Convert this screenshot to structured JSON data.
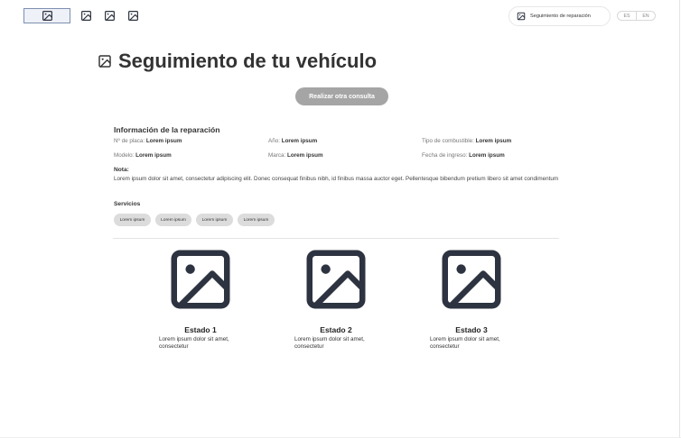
{
  "header": {
    "icons": [
      "image-icon",
      "image-icon",
      "image-icon",
      "image-icon"
    ],
    "tracking_label": "Seguimiento de reparación",
    "lang": {
      "es": "ES",
      "en": "EN"
    }
  },
  "page": {
    "title": "Seguimiento de tu vehículo",
    "consult_button": "Realizar otra consulta"
  },
  "info": {
    "heading": "Información de la reparación",
    "fields": {
      "placa": {
        "label": "Nº de placa:",
        "value": "Lorem ipsum"
      },
      "anio": {
        "label": "Año:",
        "value": "Lorem ipsum"
      },
      "combustible": {
        "label": "Tipo de combustible:",
        "value": "Lorem ipsum"
      },
      "modelo": {
        "label": "Modelo:",
        "value": "Lorem ipsum"
      },
      "marca": {
        "label": "Marca:",
        "value": "Lorem ipsum"
      },
      "ingreso": {
        "label": "Fecha de ingreso:",
        "value": "Lorem ipsum"
      }
    },
    "note_label": "Nota:",
    "note_text": "Lorem ipsum dolor sit amet, consectetur adipiscing elit. Donec consequat finibus nibh, id finibus massa auctor eget. Pellentesque bibendum pretium libero sit amet condimentum",
    "services_label": "Servicios",
    "services": [
      "Lorem ipsum",
      "Lorem ipsum",
      "Lorem ipsum",
      "Lorem ipsum"
    ]
  },
  "states": [
    {
      "title": "Estado 1",
      "text": "Lorem ipsum dolor sit amet, consectetur"
    },
    {
      "title": "Estado 2",
      "text": "Lorem ipsum dolor sit amet, consectetur"
    },
    {
      "title": "Estado 3",
      "text": "Lorem ipsum dolor sit amet, consectetur"
    }
  ],
  "colors": {
    "icon_dark": "#2d3340",
    "button_gray": "#a5a5a5",
    "chip_gray": "#dcdcdc"
  }
}
